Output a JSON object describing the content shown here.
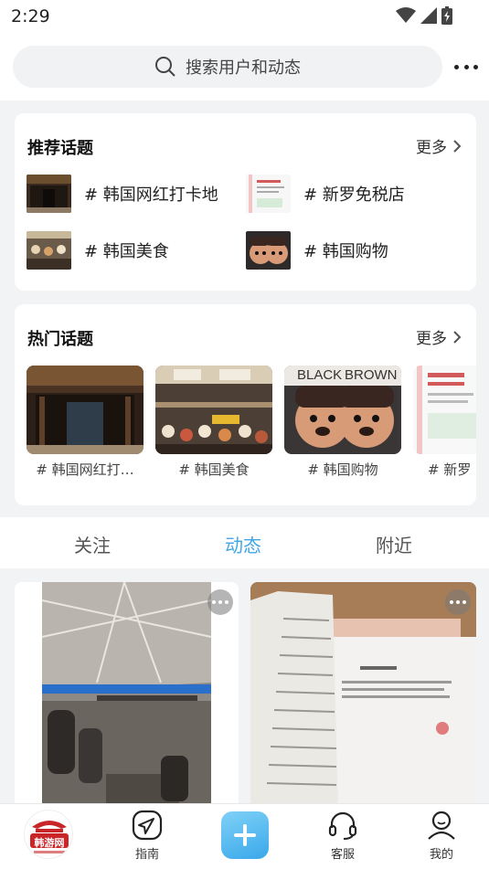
{
  "status_bar": {
    "time": "2:29"
  },
  "search": {
    "placeholder": "搜索用户和动态"
  },
  "recommended": {
    "title": "推荐话题",
    "more": "更多",
    "items": [
      {
        "label": "# 韩国网红打卡地",
        "thumb": "palace-photo"
      },
      {
        "label": "# 新罗免税店",
        "thumb": "document-photo"
      },
      {
        "label": "# 韩国美食",
        "thumb": "food-photo"
      },
      {
        "label": "# 韩国购物",
        "thumb": "dolls-photo"
      }
    ]
  },
  "hot": {
    "title": "热门话题",
    "more": "更多",
    "items": [
      {
        "label": "# 韩国网红打…",
        "thumb": "palace-photo"
      },
      {
        "label": "# 韩国美食",
        "thumb": "food-photo"
      },
      {
        "label": "# 韩国购物",
        "thumb": "dolls-photo",
        "overlay_left": "BLACK",
        "overlay_right": "BROWN"
      },
      {
        "label": "# 新罗",
        "thumb": "document-photo"
      }
    ]
  },
  "tabs": [
    {
      "label": "关注",
      "active": false
    },
    {
      "label": "动态",
      "active": true
    },
    {
      "label": "附近",
      "active": false
    }
  ],
  "feed": [
    {
      "image": "airport-photo"
    },
    {
      "image": "receipt-photo"
    }
  ],
  "bottom_nav": {
    "logo_text": "韩游网",
    "items": [
      {
        "label": "指南",
        "icon": "compass-icon"
      },
      {
        "label": "",
        "icon": "plus-icon"
      },
      {
        "label": "客服",
        "icon": "headset-icon"
      },
      {
        "label": "我的",
        "icon": "profile-icon"
      }
    ]
  },
  "colors": {
    "accent": "#3fa6e8",
    "background": "#f2f3f5"
  }
}
